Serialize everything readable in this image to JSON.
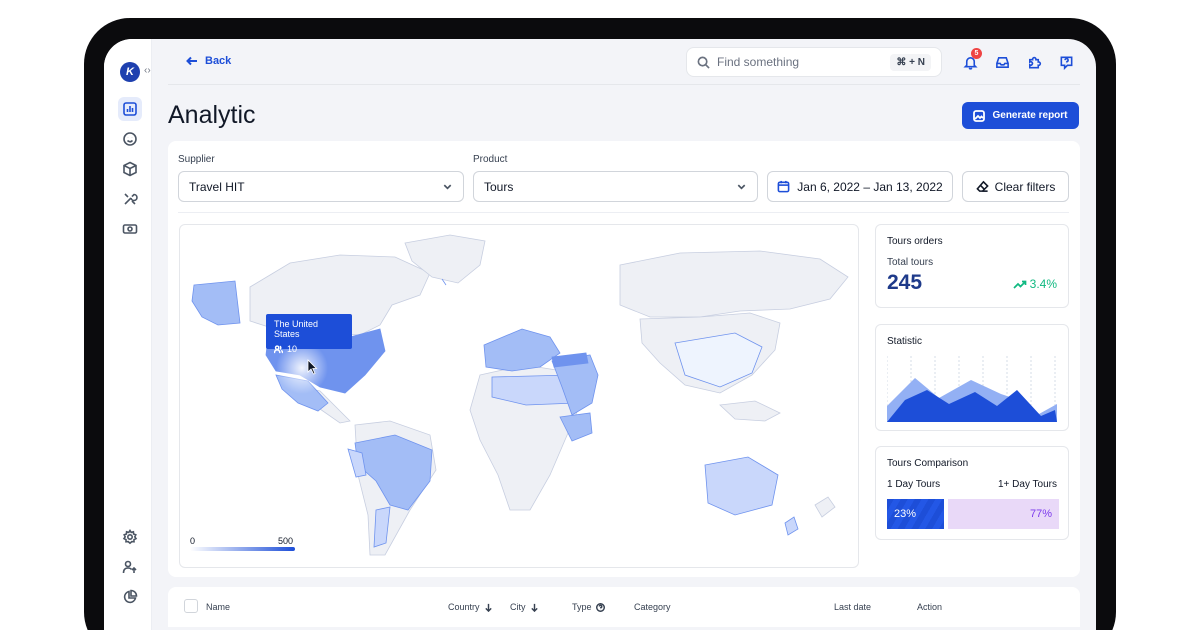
{
  "header": {
    "back_label": "Back",
    "search_placeholder": "Find something",
    "search_shortcut": "⌘ + N",
    "notification_count": "5"
  },
  "page": {
    "title": "Analytic",
    "generate_report_label": "Generate report"
  },
  "filters": {
    "supplier_label": "Supplier",
    "supplier_value": "Travel HIT",
    "product_label": "Product",
    "product_value": "Tours",
    "date_range": "Jan 6, 2022 – Jan 13, 2022",
    "clear_label": "Clear filters"
  },
  "map": {
    "tooltip_country": "The United States",
    "tooltip_count": "10",
    "scale_min": "0",
    "scale_max": "500",
    "accent": "#1d4ed8",
    "land_color": "#eef0f5",
    "highlight_light": "#c9d7fb",
    "highlight_mid": "#a3bdf6",
    "highlight_dark": "#6f93ee"
  },
  "cards": {
    "orders": {
      "title": "Tours orders",
      "total_label": "Total tours",
      "total_value": "245",
      "trend": "3.4%"
    },
    "statistic": {
      "title": "Statistic"
    },
    "comparison": {
      "title": "Tours Comparison",
      "left_label": "1 Day Tours",
      "right_label": "1+ Day Tours",
      "left_value": "23%",
      "right_value": "77%",
      "left_pct": 23,
      "right_pct": 77
    }
  },
  "table": {
    "columns": [
      "Name",
      "Country",
      "City",
      "Type",
      "Category",
      "Last date",
      "Action"
    ]
  }
}
